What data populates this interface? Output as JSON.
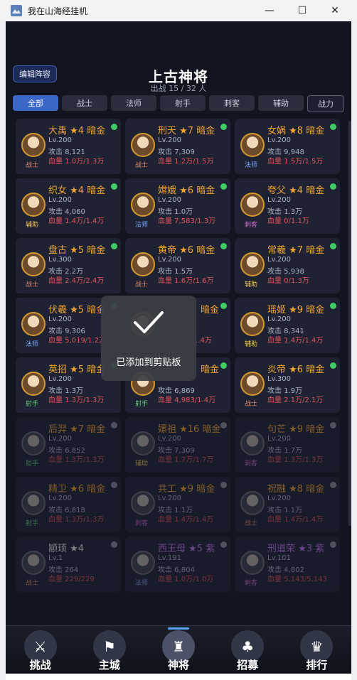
{
  "window": {
    "title": "我在山海经挂机",
    "min_glyph": "—",
    "max_glyph": "☐",
    "close_glyph": "✕"
  },
  "header": {
    "edit_label": "编辑阵容",
    "title": "上古神将",
    "subtitle": "出战 15 / 32 人"
  },
  "tabs": [
    {
      "label": "全部"
    },
    {
      "label": "战士"
    },
    {
      "label": "法师"
    },
    {
      "label": "射手"
    },
    {
      "label": "刺客"
    },
    {
      "label": "辅助"
    },
    {
      "label": "战力"
    }
  ],
  "heroes": [
    {
      "name": "大禹 ★4 暗金",
      "lv": "Lv.200",
      "atk": "攻击 8,121",
      "hp": "血量 1.0万/1.3万",
      "role": "战士"
    },
    {
      "name": "刑天 ★7 暗金",
      "lv": "Lv.200",
      "atk": "攻击 7,309",
      "hp": "血量 1.2万/1.5万",
      "role": "战士"
    },
    {
      "name": "女娲 ★8 暗金",
      "lv": "Lv.200",
      "atk": "攻击 9,948",
      "hp": "血量 1.5万/1.5万",
      "role": "法师"
    },
    {
      "name": "织女 ★4 暗金",
      "lv": "Lv.200",
      "atk": "攻击 4,060",
      "hp": "血量 1.4万/1.4万",
      "role": "辅助"
    },
    {
      "name": "嫦娥 ★6 暗金",
      "lv": "Lv.200",
      "atk": "攻击 1.0万",
      "hp": "血量 7,583/1.3万",
      "role": "法师"
    },
    {
      "name": "夸父 ★4 暗金",
      "lv": "Lv.200",
      "atk": "攻击 1.3万",
      "hp": "血量 0/1.1万",
      "role": "刺客"
    },
    {
      "name": "盘古 ★5 暗金",
      "lv": "Lv.300",
      "atk": "攻击 2.2万",
      "hp": "血量 2.4万/2.4万",
      "role": "战士"
    },
    {
      "name": "黄帝 ★6 暗金",
      "lv": "Lv.200",
      "atk": "攻击 1.5万",
      "hp": "血量 1.6万/1.6万",
      "role": "战士"
    },
    {
      "name": "常羲 ★7 暗金",
      "lv": "Lv.200",
      "atk": "攻击 5,938",
      "hp": "血量 0/1.3万",
      "role": "辅助"
    },
    {
      "name": "伏羲 ★5 暗金",
      "lv": "Lv.200",
      "atk": "攻击 9,306",
      "hp": "血量 5,019/1.2万",
      "role": "法师"
    },
    {
      "name": "暗金",
      "lv": "",
      "atk": "",
      "hp": "1.4万",
      "role": ""
    },
    {
      "name": "瑶姬 ★9 暗金",
      "lv": "Lv.200",
      "atk": "攻击 8,341",
      "hp": "血量 1.4万/1.4万",
      "role": "辅助"
    },
    {
      "name": "英招 ★5 暗金",
      "lv": "Lv.200",
      "atk": "攻击 1.3万",
      "hp": "血量 1.3万/1.3万",
      "role": "射手"
    },
    {
      "name": "暗金",
      "lv": "",
      "atk": "攻击 6,869",
      "hp": "血量 4,983/1.4万",
      "role": "射手"
    },
    {
      "name": "炎帝 ★6 暗金",
      "lv": "Lv.300",
      "atk": "攻击 1.9万",
      "hp": "血量 2.1万/2.1万",
      "role": "战士"
    },
    {
      "name": "后羿 ★7 暗金",
      "lv": "Lv.200",
      "atk": "攻击 6,852",
      "hp": "血量 1.3万/1.3万",
      "role": "射手"
    },
    {
      "name": "嫘祖 ★16 暗金",
      "lv": "Lv.200",
      "atk": "攻击 7,309",
      "hp": "血量 1.7万/1.7万",
      "role": "辅助"
    },
    {
      "name": "句芒 ★9 暗金",
      "lv": "Lv.200",
      "atk": "攻击 1.7万",
      "hp": "血量 1.3万/1.3万",
      "role": "刺客"
    },
    {
      "name": "精卫 ★6 暗金",
      "lv": "Lv.200",
      "atk": "攻击 6,818",
      "hp": "血量 1.3万/1.3万",
      "role": "射手"
    },
    {
      "name": "共工 ★9 暗金",
      "lv": "Lv.200",
      "atk": "攻击 1.1万",
      "hp": "血量 1.4万/1.4万",
      "role": "刺客"
    },
    {
      "name": "祝融 ★8 暗金",
      "lv": "Lv.200",
      "atk": "攻击 1.1万",
      "hp": "血量 1.4万/1.4万",
      "role": "战士"
    },
    {
      "name": "颛顼 ★4",
      "lv": "Lv.1",
      "atk": "攻击 264",
      "hp": "血量 229/229",
      "role": "战士"
    },
    {
      "name": "西王母 ★5 紫",
      "lv": "Lv.191",
      "atk": "攻击 6,804",
      "hp": "血量 1.0万/1.0万",
      "role": "法师"
    },
    {
      "name": "刑道荣 ★3 紫",
      "lv": "Lv.101",
      "atk": "攻击 4,802",
      "hp": "血量 5,143/5,143",
      "role": "刺客"
    }
  ],
  "toast": {
    "text": "已添加到剪贴板"
  },
  "nav": [
    {
      "label": "挑战"
    },
    {
      "label": "主城"
    },
    {
      "label": "神将"
    },
    {
      "label": "招募"
    },
    {
      "label": "排行"
    }
  ]
}
